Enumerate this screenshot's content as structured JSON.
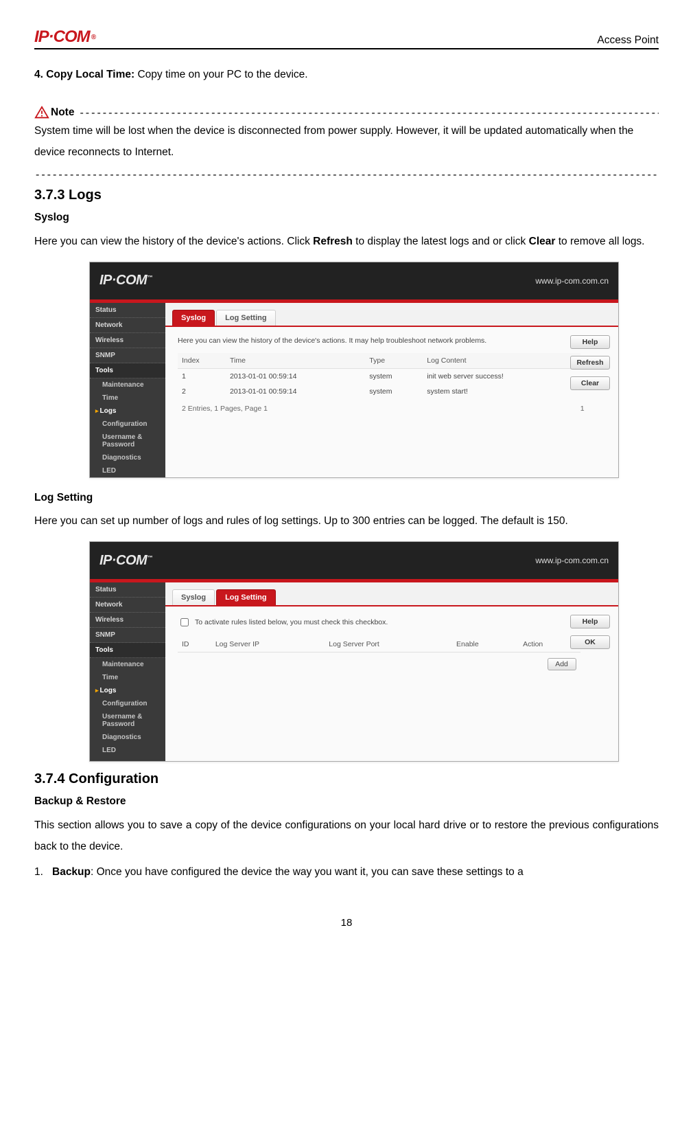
{
  "header": {
    "logo_text": "IP·COM",
    "logo_reg": "®",
    "right": "Access Point"
  },
  "section4": {
    "title": "4. Copy Local Time:",
    "text": " Copy time on your PC to the device."
  },
  "note": {
    "label": "Note",
    "body": "System time will be lost when the device is disconnected from power supply. However, it will be updated automatically when the device reconnects to Internet."
  },
  "dashes": "-----------------------------------------------------------------------------------------------------------------------------------------",
  "full_dashes": "-----------------------------------------------------------------------------------------------------------------------------------------------",
  "logs": {
    "heading": "3.7.3 Logs",
    "syslog_title": "Syslog",
    "syslog_text_1": "Here you can view the history of the device's actions. Click ",
    "syslog_bold_1": "Refresh",
    "syslog_text_2": " to display the latest logs and or click ",
    "syslog_bold_2": "Clear",
    "syslog_text_3": " to remove all logs.",
    "log_setting_title": "Log Setting",
    "log_setting_text": "Here you can set up number of logs and rules of log settings. Up to 300 entries can be logged. The default is 150."
  },
  "config": {
    "heading": "3.7.4 Configuration",
    "backup_title": "Backup & Restore",
    "backup_text": "This section allows you to save a copy of the device configurations on your local hard drive or to restore the previous configurations back to the device.",
    "item1_num": "1.",
    "item1_bold": "Backup",
    "item1_text": ": Once you have configured the device the way you want it, you can save these settings to a"
  },
  "page_num": "18",
  "shot1": {
    "logo": "IP·COM",
    "tm": "™",
    "url": "www.ip-com.com.cn",
    "sidebar": [
      "Status",
      "Network",
      "Wireless",
      "SNMP",
      "Tools"
    ],
    "tools_sub": [
      "Maintenance",
      "Time",
      "Logs",
      "Configuration",
      "Username & Password",
      "Diagnostics",
      "LED"
    ],
    "tools_active": "Logs",
    "tabs": [
      "Syslog",
      "Log Setting"
    ],
    "active_tab": 0,
    "desc": "Here you can view the history of the device's actions. It may help troubleshoot network problems.",
    "columns": [
      "Index",
      "Time",
      "Type",
      "Log Content"
    ],
    "rows": [
      {
        "index": "1",
        "time": "2013-01-01 00:59:14",
        "type": "system",
        "content": "init web server success!"
      },
      {
        "index": "2",
        "time": "2013-01-01 00:59:14",
        "type": "system",
        "content": "system start!"
      }
    ],
    "pager_left": "2 Entries, 1 Pages, Page 1",
    "pager_right": "1",
    "buttons": [
      "Help",
      "Refresh",
      "Clear"
    ]
  },
  "shot2": {
    "logo": "IP·COM",
    "tm": "™",
    "url": "www.ip-com.com.cn",
    "sidebar": [
      "Status",
      "Network",
      "Wireless",
      "SNMP",
      "Tools"
    ],
    "tools_sub": [
      "Maintenance",
      "Time",
      "Logs",
      "Configuration",
      "Username & Password",
      "Diagnostics",
      "LED"
    ],
    "tools_active": "Logs",
    "tabs": [
      "Syslog",
      "Log Setting"
    ],
    "active_tab": 1,
    "checkbox_label": "To activate rules listed below, you must check this checkbox.",
    "columns": [
      "ID",
      "Log Server IP",
      "Log Server Port",
      "Enable",
      "Action"
    ],
    "add_btn": "Add",
    "buttons": [
      "Help",
      "OK"
    ]
  }
}
